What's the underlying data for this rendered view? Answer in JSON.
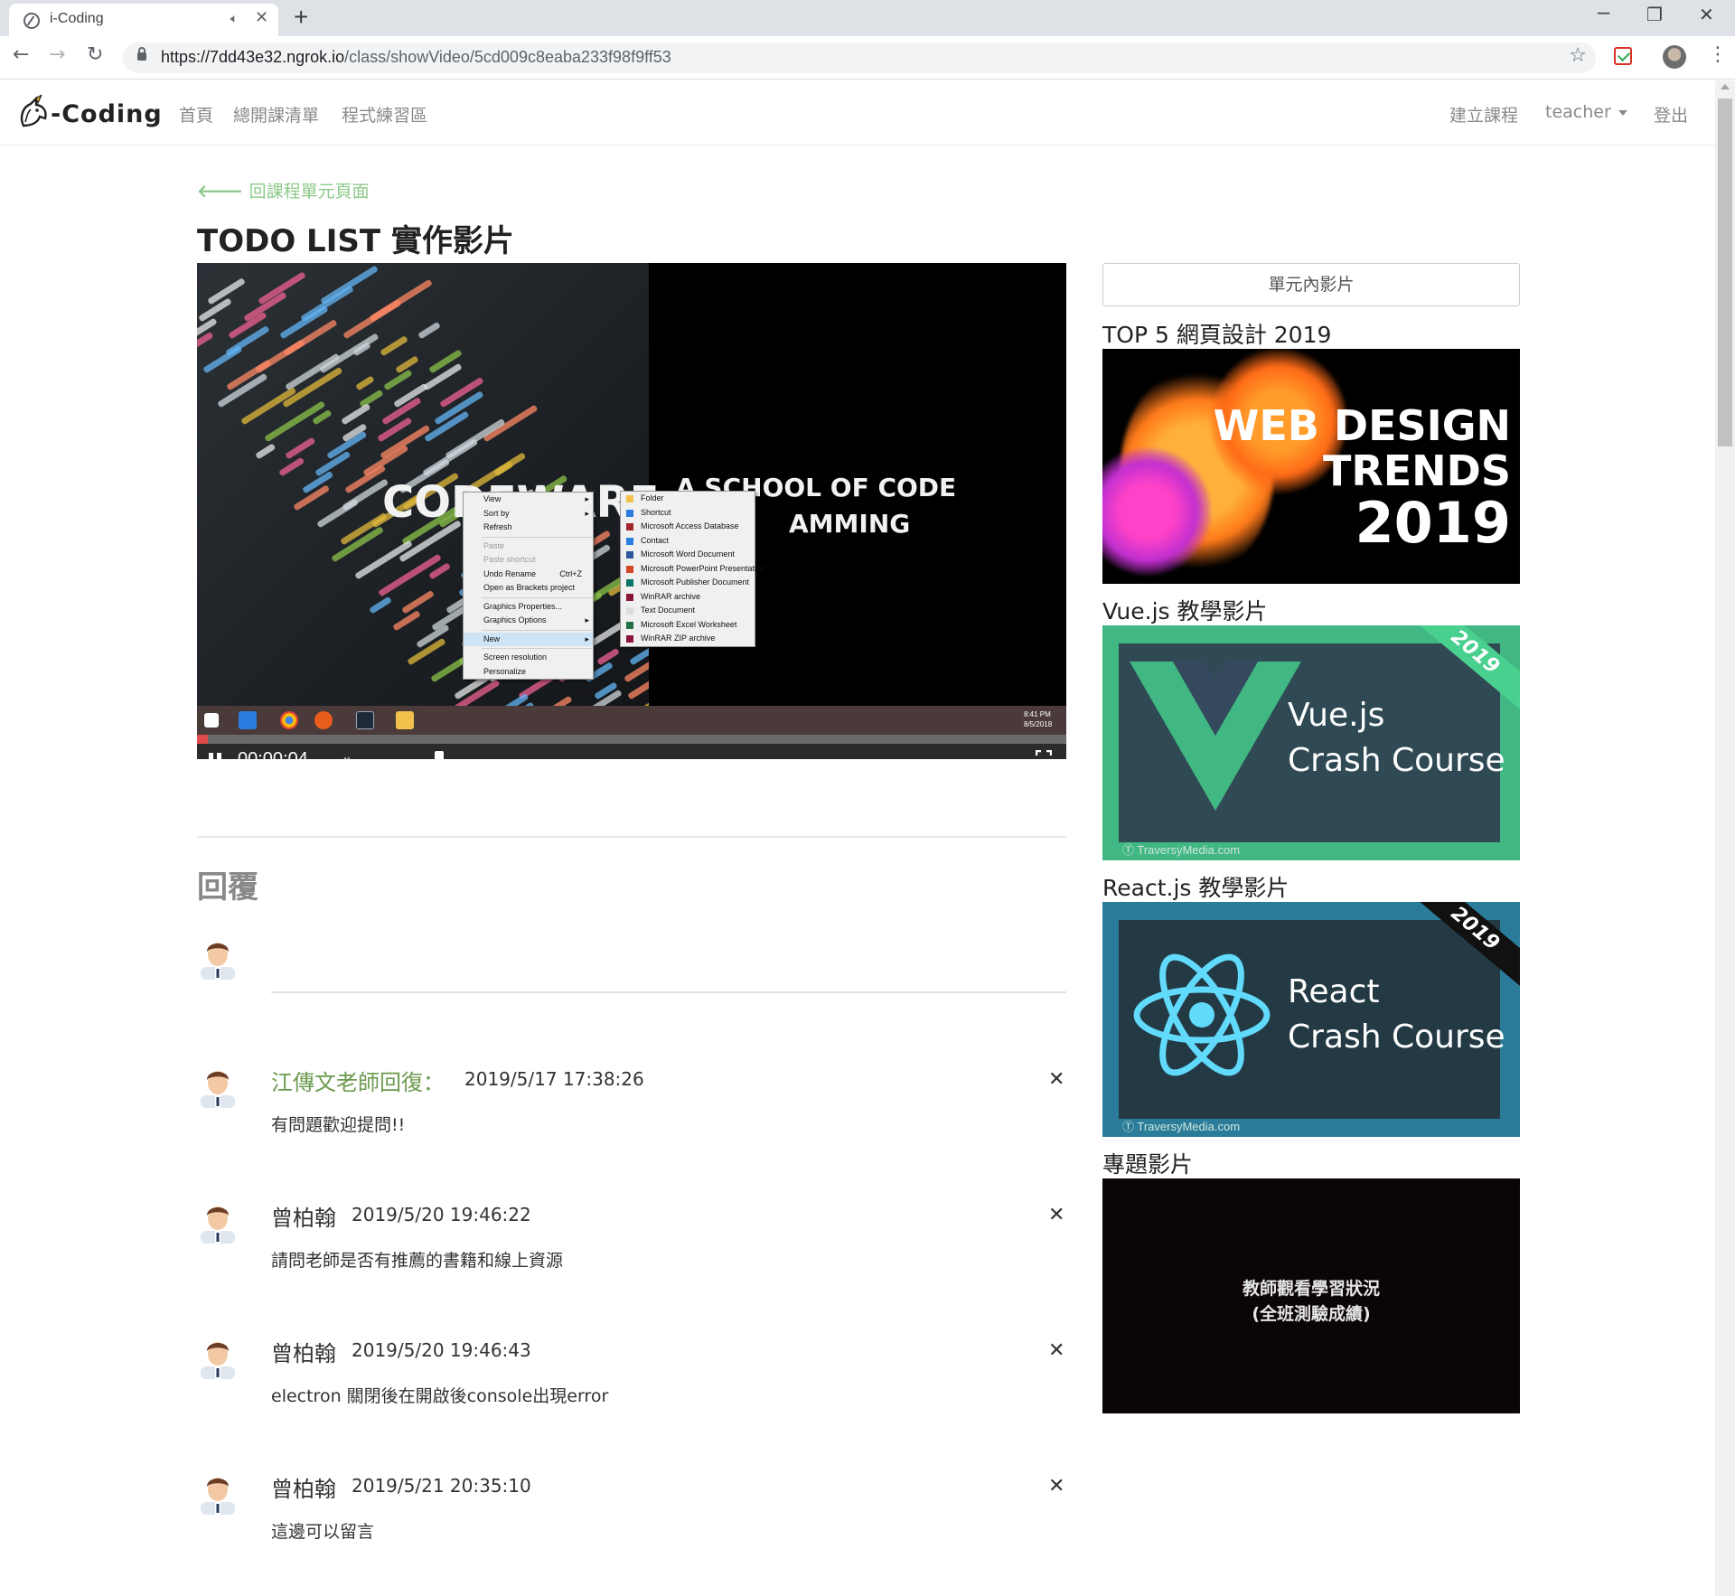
{
  "browser": {
    "tab_title": "i-Coding",
    "tab_audio_icon": "speaker-icon",
    "new_tab_label": "+",
    "url_host": "https://7dd43e32.ngrok.io",
    "url_path": "/class/showVideo/5cd009c8eaba233f98f9ff53",
    "window_controls": {
      "minimize": "–",
      "maximize": "❐",
      "close": "✕"
    }
  },
  "navbar": {
    "brand": "-Coding",
    "links": [
      "首頁",
      "總開課清單",
      "程式練習區"
    ],
    "create_course": "建立課程",
    "user": "teacher",
    "logout": "登出"
  },
  "back_link": "回課程單元頁面",
  "title": "TODO LIST 實作影片",
  "video": {
    "overlay_left": "CODEWARE",
    "overlay_right_1": "A SCHOOL OF CODE",
    "overlay_right_2": "AMMING",
    "context_menu": [
      {
        "label": "View",
        "arrow": true
      },
      {
        "label": "Sort by",
        "arrow": true
      },
      {
        "label": "Refresh"
      },
      {
        "sep": true
      },
      {
        "label": "Paste",
        "disabled": true
      },
      {
        "label": "Paste shortcut",
        "disabled": true
      },
      {
        "label": "Undo Rename",
        "shortcut": "Ctrl+Z"
      },
      {
        "label": "Open as Brackets project"
      },
      {
        "sep": true
      },
      {
        "label": "Graphics Properties..."
      },
      {
        "label": "Graphics Options",
        "arrow": true
      },
      {
        "sep": true
      },
      {
        "label": "New",
        "arrow": true,
        "highlight": true
      },
      {
        "sep": true
      },
      {
        "label": "Screen resolution"
      },
      {
        "label": "Personalize"
      }
    ],
    "new_submenu": [
      "Folder",
      "Shortcut",
      "Microsoft Access Database",
      "Contact",
      "Microsoft Word Document",
      "Microsoft PowerPoint Presentation",
      "Microsoft Publisher Document",
      "WinRAR archive",
      "Text Document",
      "Microsoft Excel Worksheet",
      "WinRAR ZIP archive"
    ],
    "taskbar_clock_time": "8:41 PM",
    "taskbar_clock_date": "8/5/2018",
    "current_time": "00:00:04",
    "progress_fraction": 0.012,
    "volume_fraction": 0.5
  },
  "replies": {
    "heading": "回覆",
    "comments": [
      {
        "author": "江傳文老師回復：",
        "time": "2019/5/17 17:38:26",
        "body": "有問題歡迎提問!!",
        "teacher": true
      },
      {
        "author": "曾柏翰",
        "time": "2019/5/20 19:46:22",
        "body": "請問老師是否有推薦的書籍和線上資源"
      },
      {
        "author": "曾柏翰",
        "time": "2019/5/20 19:46:43",
        "body": "electron 關閉後在開啟後console出現error"
      },
      {
        "author": "曾柏翰",
        "time": "2019/5/21 20:35:10",
        "body": "這邊可以留言"
      }
    ],
    "delete_glyph": "✕"
  },
  "sidebar": {
    "button": "單元內影片",
    "videos": [
      {
        "title": "TOP 5 網頁設計 2019",
        "thumb_lines": [
          "WEB DESIGN",
          "TRENDS",
          "2019"
        ]
      },
      {
        "title": "Vue.js 教學影片",
        "thumb_lines": [
          "Vue.js",
          "Crash Course"
        ],
        "badge": "2019",
        "credit": "TraversyMedia.com"
      },
      {
        "title": "React.js 教學影片",
        "thumb_lines": [
          "React",
          "Crash Course"
        ],
        "badge": "2019",
        "credit": "TraversyMedia.com"
      },
      {
        "title": "專題影片",
        "thumb_lines": [
          "教師觀看學習狀況",
          "(全班測驗成績)"
        ]
      }
    ]
  },
  "colors": {
    "accent_green": "#8cc98a",
    "teacher_name": "#6c9a4f",
    "progress_red": "#e04b4b",
    "vue_green": "#41b883",
    "react_blue": "#61dafb"
  }
}
